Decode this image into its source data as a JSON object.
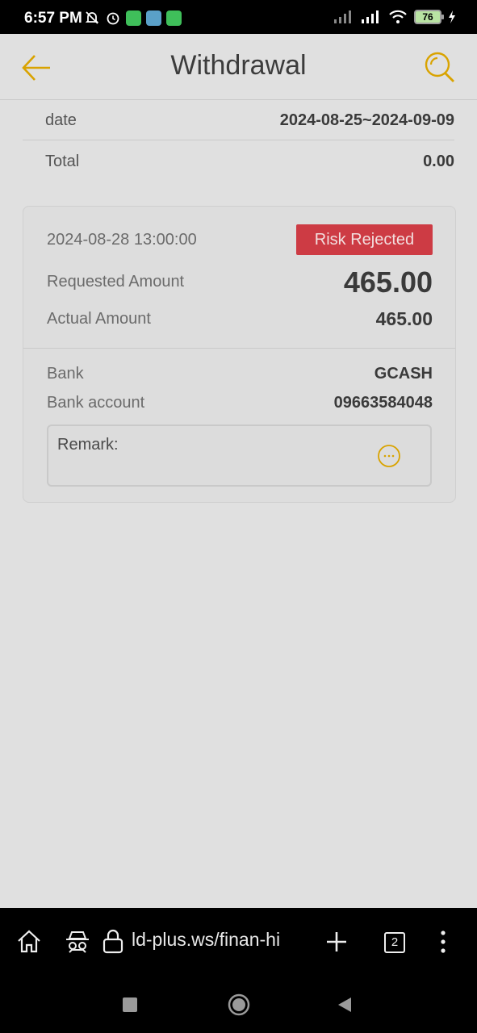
{
  "status_bar": {
    "time": "6:57 PM",
    "battery": "76",
    "icons": [
      "muted-alarm-icon",
      "alarm-clock-icon",
      "app-icon-green",
      "app-icon-blue",
      "app-icon-green-2",
      "signal-icon",
      "signal-icon-2",
      "wifi-icon",
      "battery-icon",
      "charging-icon"
    ]
  },
  "header": {
    "title": "Withdrawal",
    "accent_color": "#d9a300"
  },
  "summary": {
    "date_label": "date",
    "date_value": "2024-08-25~2024-09-09",
    "total_label": "Total",
    "total_value": "0.00"
  },
  "record": {
    "datetime": "2024-08-28 13:00:00",
    "status": "Risk Rejected",
    "status_color": "#cd3b44",
    "requested_label": "Requested Amount",
    "requested_value": "465.00",
    "actual_label": "Actual Amount",
    "actual_value": "465.00",
    "bank_label": "Bank",
    "bank_value": "GCASH",
    "account_label": "Bank account",
    "account_value": "09663584048",
    "remark_label": "Remark:"
  },
  "browser": {
    "url": "ld-plus.ws/finan-hi",
    "tab_count": "2"
  }
}
